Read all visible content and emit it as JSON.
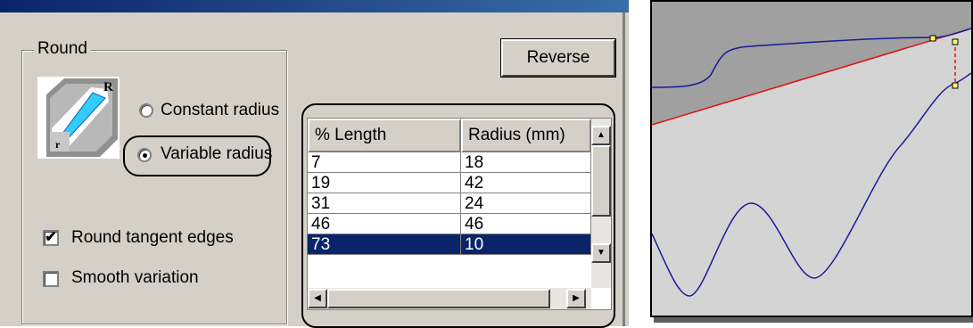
{
  "group": {
    "label": "Round"
  },
  "radios": {
    "constant": {
      "label": "Constant radius",
      "checked": false
    },
    "variable": {
      "label": "Variable radius",
      "checked": true
    }
  },
  "checkboxes": {
    "round_tangent": {
      "label": "Round tangent edges",
      "checked": true,
      "mark": "✔"
    },
    "smooth": {
      "label": "Smooth variation",
      "checked": false
    }
  },
  "reverse_button": {
    "label": "Reverse"
  },
  "icon": {
    "label_big": "R",
    "label_small": "r"
  },
  "table": {
    "headers": [
      "% Length",
      "Radius (mm)"
    ],
    "rows": [
      {
        "length": "7",
        "radius": "18"
      },
      {
        "length": "19",
        "radius": "42"
      },
      {
        "length": "31",
        "radius": "24"
      },
      {
        "length": "46",
        "radius": "46"
      },
      {
        "length": "73",
        "radius": "10",
        "selected": true
      }
    ]
  },
  "colors": {
    "graph_line": "#1a1a9a",
    "reference_line": "#e01010",
    "selection": "#0a246a",
    "panel": "#d4d0c8"
  }
}
